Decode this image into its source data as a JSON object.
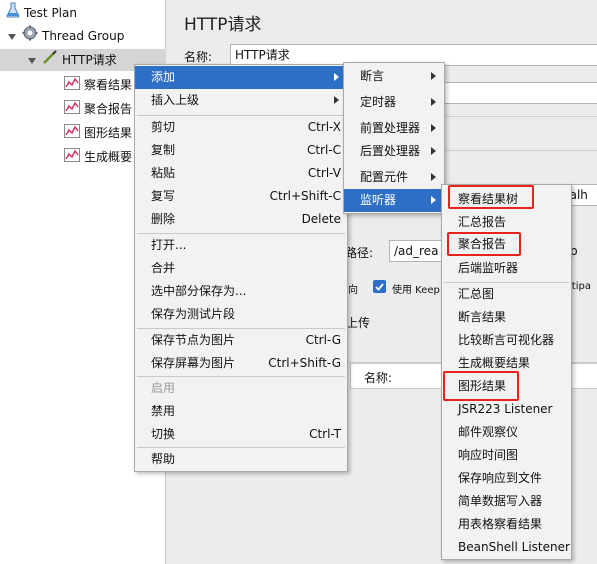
{
  "tree": {
    "test_plan": "Test Plan",
    "thread_group": "Thread Group",
    "http_request": "HTTP请求",
    "children": [
      "察看结果",
      "聚合报告",
      "图形结果",
      "生成概要"
    ]
  },
  "panel": {
    "title": "HTTP请求",
    "name_label": "名称:",
    "name_value": "HTTP请求",
    "partial_host": "calh",
    "path_label": "路径:",
    "path_value": "/ad_rea",
    "path_suffix": "p",
    "checkbox_prefix": "向",
    "keepalive_label": "使用 Keep",
    "partial_right": "ltipa",
    "upload_label": "上传",
    "param_name_label": "名称:"
  },
  "context_menu": {
    "items": [
      {
        "label": "添加",
        "submenu": true
      },
      {
        "label": "插入上级",
        "submenu": true
      },
      {
        "label": "剪切",
        "shortcut": "Ctrl-X"
      },
      {
        "label": "复制",
        "shortcut": "Ctrl-C"
      },
      {
        "label": "粘贴",
        "shortcut": "Ctrl-V"
      },
      {
        "label": "复写",
        "shortcut": "Ctrl+Shift-C"
      },
      {
        "label": "删除",
        "shortcut": "Delete"
      },
      {
        "label": "打开..."
      },
      {
        "label": "合并"
      },
      {
        "label": "选中部分保存为..."
      },
      {
        "label": "保存为测试片段"
      },
      {
        "label": "保存节点为图片",
        "shortcut": "Ctrl-G"
      },
      {
        "label": "保存屏幕为图片",
        "shortcut": "Ctrl+Shift-G"
      },
      {
        "label": "启用"
      },
      {
        "label": "禁用"
      },
      {
        "label": "切换",
        "shortcut": "Ctrl-T"
      },
      {
        "label": "帮助"
      }
    ]
  },
  "add_submenu": {
    "items": [
      "断言",
      "定时器",
      "前置处理器",
      "后置处理器",
      "配置元件",
      "监听器"
    ]
  },
  "listener_submenu": {
    "items": [
      "察看结果树",
      "汇总报告",
      "聚合报告",
      "后端监听器",
      "汇总图",
      "断言结果",
      "比较断言可视化器",
      "生成概要结果",
      "图形结果",
      "JSR223 Listener",
      "邮件观察仪",
      "响应时间图",
      "保存响应到文件",
      "简单数据写入器",
      "用表格察看结果",
      "BeanShell Listener"
    ]
  },
  "colors": {
    "highlight": "#2e6fc6",
    "annotation_red": "#e8231d",
    "menu_bg": "#f2f2f2",
    "tree_selected": "#d5d5d5"
  }
}
